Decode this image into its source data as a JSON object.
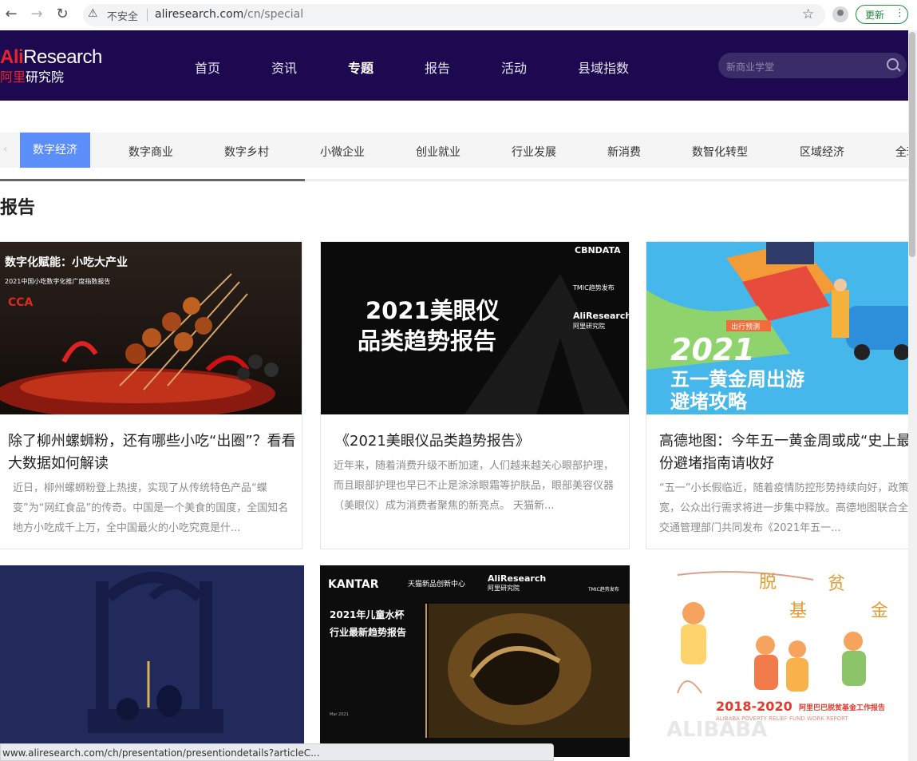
{
  "browser": {
    "security_label": "不安全",
    "url_host": "aliresearch.com",
    "url_path": "/cn/special",
    "update_label": "更新"
  },
  "site": {
    "logo_en_prefix": "Ali",
    "logo_en_suffix": "Research",
    "logo_cn_prefix": "阿里",
    "logo_cn_suffix": "研究院",
    "nav": [
      "首页",
      "资讯",
      "专题",
      "报告",
      "活动",
      "县域指数"
    ],
    "active_nav": "专题",
    "search_placeholder": "新商业学堂"
  },
  "categories": {
    "items": [
      "数字经济",
      "数字商业",
      "数字乡村",
      "小微企业",
      "创业就业",
      "行业发展",
      "新消费",
      "数智化转型",
      "区域经济",
      "全球"
    ],
    "active": "数字经济",
    "scroll_progress": 0.336
  },
  "section_title": "报告",
  "cards": [
    {
      "image_text_1": "数字化赋能：小吃大产业",
      "image_text_2": "2021中国小吃数字化推广度指数报告",
      "title": "除了柳州螺蛳粉，还有哪些小吃“出圈”？看看大数据如何解读",
      "desc": "近日，柳州螺蛳粉登上热搜，实现了从传统特色产品“蝶变”为“网红食品”的传奇。中国是一个美食的国度，全国知名地方小吃成千上万，全中国最火的小吃究竟是什..."
    },
    {
      "image_brand": "CBNDATA",
      "image_brand_sub": "TMIC趋势发布",
      "image_brand_ali": "AliResearch",
      "image_brand_ali_cn": "阿里研究院",
      "image_text_1": "2021美眼仪",
      "image_text_2": "品类趋势报告",
      "title": "《2021美眼仪品类趋势报告》",
      "desc": "近年来，随着消费升级不断加速，人们越来越关心眼部护理，而且眼部护理也早已不止是涂涂眼霜等护肤品，眼部美容仪器（美眼仪）成为消费者聚焦的新亮点。 天猫新..."
    },
    {
      "image_tag": "出行预测",
      "image_text_1": "2021",
      "image_text_2": "五一黄金周出游",
      "image_text_3": "避堵攻略",
      "title": "高德地图：今年五一黄金周或成“史上最堵”这份避堵指南请收好",
      "desc": "“五一”小长假临近，随着疫情防控形势持续向好，政策逐步放宽，公众出行需求将进一步集中释放。高德地图联合全国多地交通管理部门共同发布《2021年五一..."
    }
  ],
  "cards_row2": [
    {
      "image": "dark-arch"
    },
    {
      "image_brand_left": "KANTAR",
      "image_brand_mid": "天猫新品创新中心",
      "image_brand_right": "AliResearch",
      "image_brand_right_cn": "阿里研究院",
      "image_brand_tmic": "TMIC趋势发布",
      "image_text_1": "2021年儿童水杯",
      "image_text_2": "行业最新趋势报告",
      "image_date": "Mar 2021"
    },
    {
      "image_text_chars": [
        "脱",
        "贫",
        "基",
        "金"
      ],
      "image_years": "2018-2020",
      "image_caption": "阿里巴巴脱贫基金工作报告",
      "image_caption_en": "ALIBABA POVERTY RELIEF FUND WORK REPORT",
      "image_watermark": "ALIBABA"
    }
  ],
  "status_url": "www.aliresearch.com/ch/presentation/presentiondetails?articleC..."
}
